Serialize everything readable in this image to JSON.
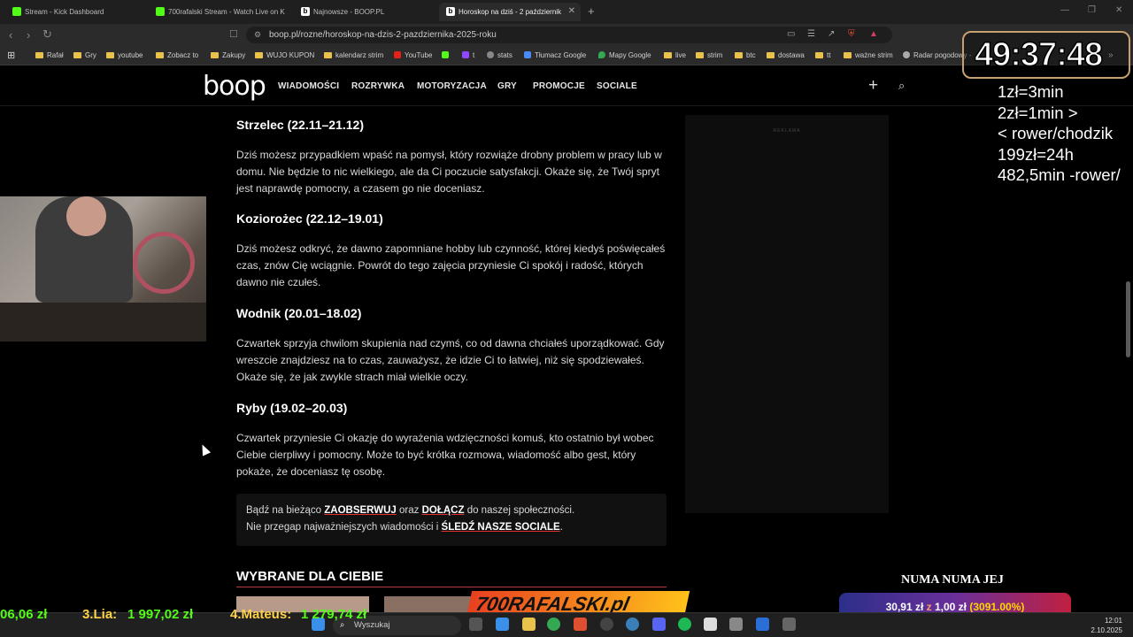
{
  "browser": {
    "tabs": [
      {
        "label": "Stream - Kick Dashboard",
        "icon": "kick-icon"
      },
      {
        "label": "700rafalski Stream - Watch Live on K",
        "icon": "kick-icon"
      },
      {
        "label": "Najnowsze - BOOP.PL",
        "icon": "boop-icon"
      },
      {
        "label": "Horoskop na dziś - 2 październik",
        "icon": "boop-icon",
        "active": true
      }
    ],
    "url": "boop.pl/rozne/horoskop-na-dzis-2-pazdziernika-2025-roku",
    "bookmarks": [
      "Rafał",
      "Gry",
      "youtube",
      "Zobacz to",
      "Zakupy",
      "WUJO KUPON",
      "kalendarz strim",
      "YouTube",
      "t",
      "stats",
      "Tłumacz Google",
      "Mapy Google",
      "live",
      "strim",
      "btc",
      "dostawa",
      "tt",
      "ważne strim",
      "Radar pogodowy -"
    ]
  },
  "site": {
    "logo": "boop",
    "nav": [
      "WIADOMOŚCI",
      "ROZRYWKA",
      "MOTORYZACJA",
      "GRY",
      "PROMOCJE",
      "SOCIALE"
    ]
  },
  "article": {
    "sections": [
      {
        "sign": "Strzelec (22.11–21.12)",
        "text": "Dziś możesz przypadkiem wpaść na pomysł, który rozwiąże drobny problem w pracy lub w domu. Nie będzie to nic wielkiego, ale da Ci poczucie satysfakcji. Okaże się, że Twój spryt jest naprawdę pomocny, a czasem go nie doceniasz."
      },
      {
        "sign": "Koziorożec (22.12–19.01)",
        "text": "Dziś możesz odkryć, że dawno zapomniane hobby lub czynność, której kiedyś poświęcałeś czas, znów Cię wciągnie. Powrót do tego zajęcia przyniesie Ci spokój i radość, których dawno nie czułeś."
      },
      {
        "sign": "Wodnik (20.01–18.02)",
        "text": "Czwartek sprzyja chwilom skupienia nad czymś, co od dawna chciałeś uporządkować. Gdy wreszcie znajdziesz na to czas, zauważysz, że idzie Ci to łatwiej, niż się spodziewałeś. Okaże się, że jak zwykle strach miał wielkie oczy."
      },
      {
        "sign": "Ryby (19.02–20.03)",
        "text": "Czwartek przyniesie Ci okazję do wyrażenia wdzięczności komuś, kto ostatnio był wobec Ciebie cierpliwy i pomocny. Może to być krótka rozmowa, wiadomość albo gest, który pokaże, że doceniasz tę osobę."
      }
    ],
    "cta": {
      "l1_a": "Bądź na bieżąco ",
      "l1_link1": "ZAOBSERWUJ",
      "l1_b": " oraz ",
      "l1_link2": "DOŁĄCZ",
      "l1_c": " do naszej społeczności.",
      "l2_a": "Nie przegap najważniejszych wiadomości i ",
      "l2_link": "ŚLEDŹ NASZE SOCIALE",
      "l2_b": "."
    },
    "recommended_title": "WYBRANE DLA CIEBIE"
  },
  "ad": {
    "label": "REKLAMA"
  },
  "overlay": {
    "timer": "49:37:48",
    "rules": [
      "1zł=3min",
      "2zł=1min >",
      "< rower/chodzik",
      "199zł=24h",
      "482,5min -rower/"
    ],
    "song": "NUMA NUMA JEJ",
    "donation_amount": "30,91 zł",
    "donation_sep": " z ",
    "donation_goal": "1,00 zł",
    "donation_pct": " (3091.00%)",
    "ticker": [
      "06,06 zł",
      "3.Lia: ",
      "1 997,02 zł",
      "4.Mateus: ",
      "1 279,74 zł"
    ],
    "brand": "700RAFALSKI.pl"
  },
  "taskbar": {
    "search_placeholder": "Wyszukaj",
    "time": "12:01",
    "date": "2.10.2025"
  },
  "colors": {
    "accent_red": "#e03030",
    "kick_green": "#53fc18",
    "bookmark_folder": "#e8c24a",
    "ticker_green": "#53fc18"
  }
}
